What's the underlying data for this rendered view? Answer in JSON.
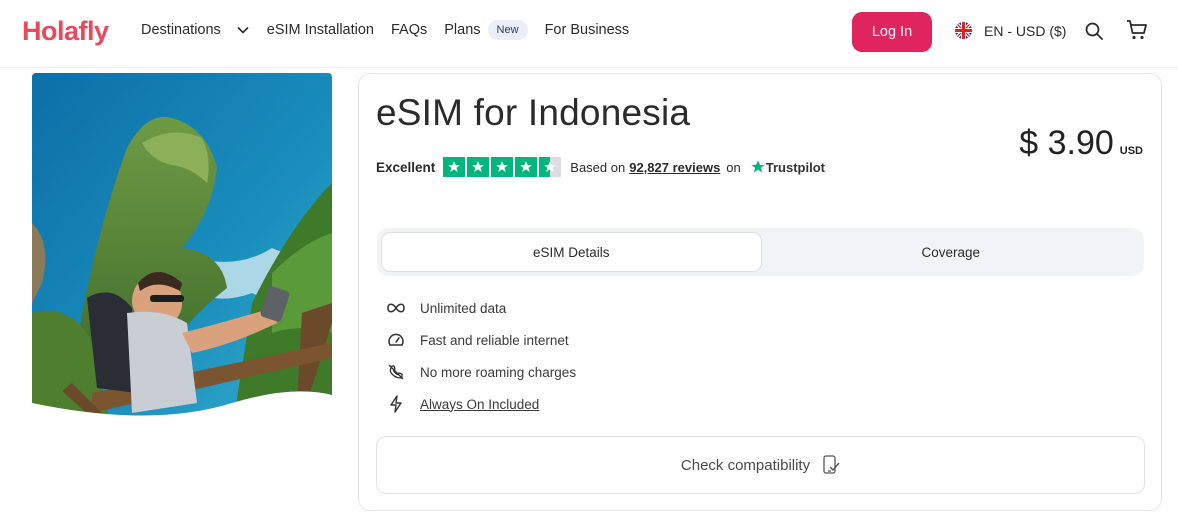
{
  "header": {
    "logo": "Holafly",
    "nav": [
      {
        "label": "Destinations"
      },
      {
        "label": "eSIM Installation"
      },
      {
        "label": "FAQs"
      },
      {
        "label": "Plans",
        "badge": "New"
      },
      {
        "label": "For Business"
      }
    ],
    "login_label": "Log In",
    "language_currency": "EN - USD ($)"
  },
  "product": {
    "title": "eSIM for Indonesia",
    "rating_label": "Excellent",
    "reviews_prefix": "Based on",
    "reviews_count": "92,827 reviews",
    "reviews_suffix": "on",
    "trustpilot_label": "Trustpilot",
    "stars": 4.5,
    "price": "$ 3.90",
    "currency": "USD"
  },
  "tabs": [
    {
      "label": "eSIM Details",
      "active": true
    },
    {
      "label": "Coverage",
      "active": false
    }
  ],
  "features": [
    {
      "icon": "infinity-icon",
      "label": "Unlimited data"
    },
    {
      "icon": "speedometer-icon",
      "label": "Fast and reliable internet"
    },
    {
      "icon": "no-roaming-icon",
      "label": "No more roaming charges"
    },
    {
      "icon": "lightning-icon",
      "label": "Always On Included"
    }
  ],
  "check_compatibility_label": "Check compatibility",
  "colors": {
    "brand": "#e8495c",
    "login_button": "#e0245e",
    "trustpilot_green": "#00b67a"
  }
}
